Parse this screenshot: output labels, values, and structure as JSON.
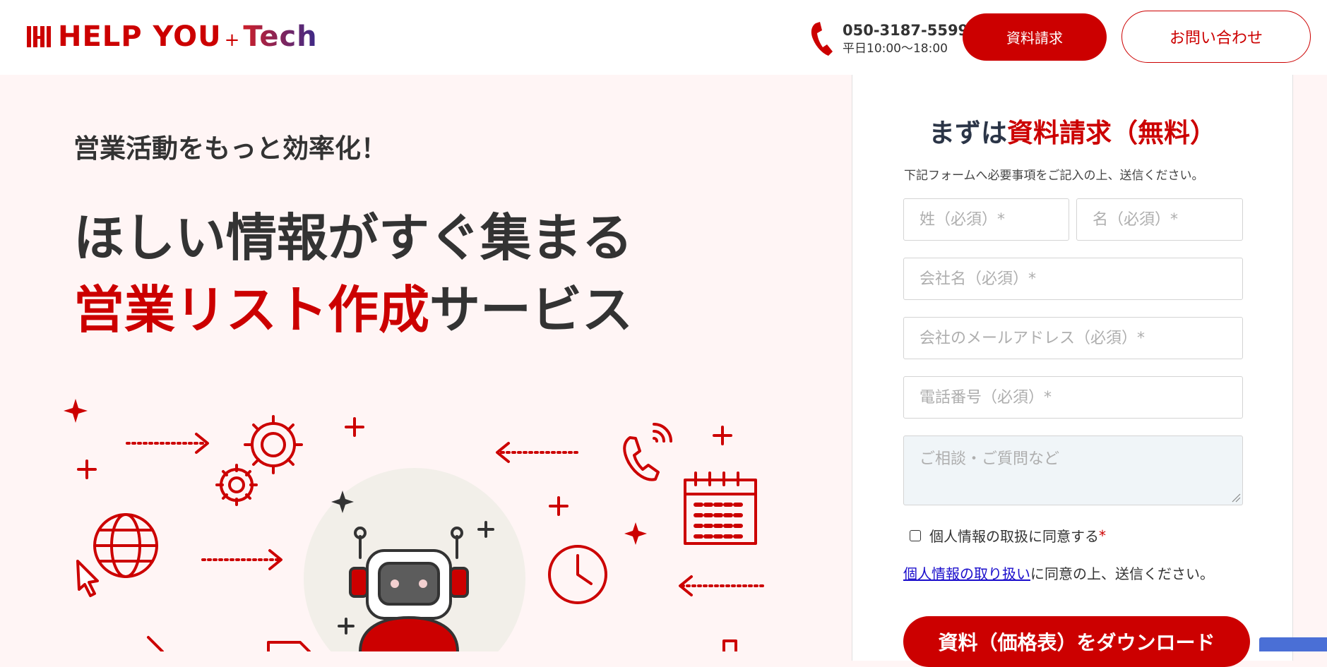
{
  "header": {
    "logo_main": "HELP YOU",
    "logo_plus": "+",
    "logo_tech": "Tech",
    "phone_number": "050-3187-5599",
    "phone_hours": "平日10:00〜18:00",
    "doc_request_label": "資料請求",
    "contact_label": "お問い合わせ"
  },
  "hero": {
    "tagline": "営業活動をもっと効率化！",
    "headline_line1": "ほしい情報がすぐ集まる",
    "headline_red": "営業リスト作成",
    "headline_rest": "サービス"
  },
  "form": {
    "heading_prefix": "まずは",
    "heading_red": "資料請求（無料）",
    "description": "下記フォームへ必要事項をご記入の上、送信ください。",
    "last_name_placeholder": "姓（必須）*",
    "first_name_placeholder": "名（必須）*",
    "company_placeholder": "会社名（必須）*",
    "email_placeholder": "会社のメールアドレス（必須）*",
    "tel_placeholder": "電話番号（必須）*",
    "message_placeholder": "ご相談・ご質問など",
    "consent_label": "個人情報の取扱に同意する",
    "consent_required_mark": "*",
    "privacy_link": "個人情報の取り扱い",
    "privacy_suffix": "に同意の上、送信ください。",
    "submit_label": "資料（価格表）をダウンロード"
  },
  "colors": {
    "brand_red": "#cc0000",
    "hero_bg": "#fff5f5",
    "heading_navy": "#2b3547"
  },
  "icons": [
    "logo-mark-icon",
    "phone-icon",
    "sparkle-icon",
    "gear-icon",
    "globe-icon",
    "cursor-icon",
    "robot-icon",
    "telephone-icon",
    "calendar-icon",
    "clock-icon",
    "arrow-icon"
  ]
}
